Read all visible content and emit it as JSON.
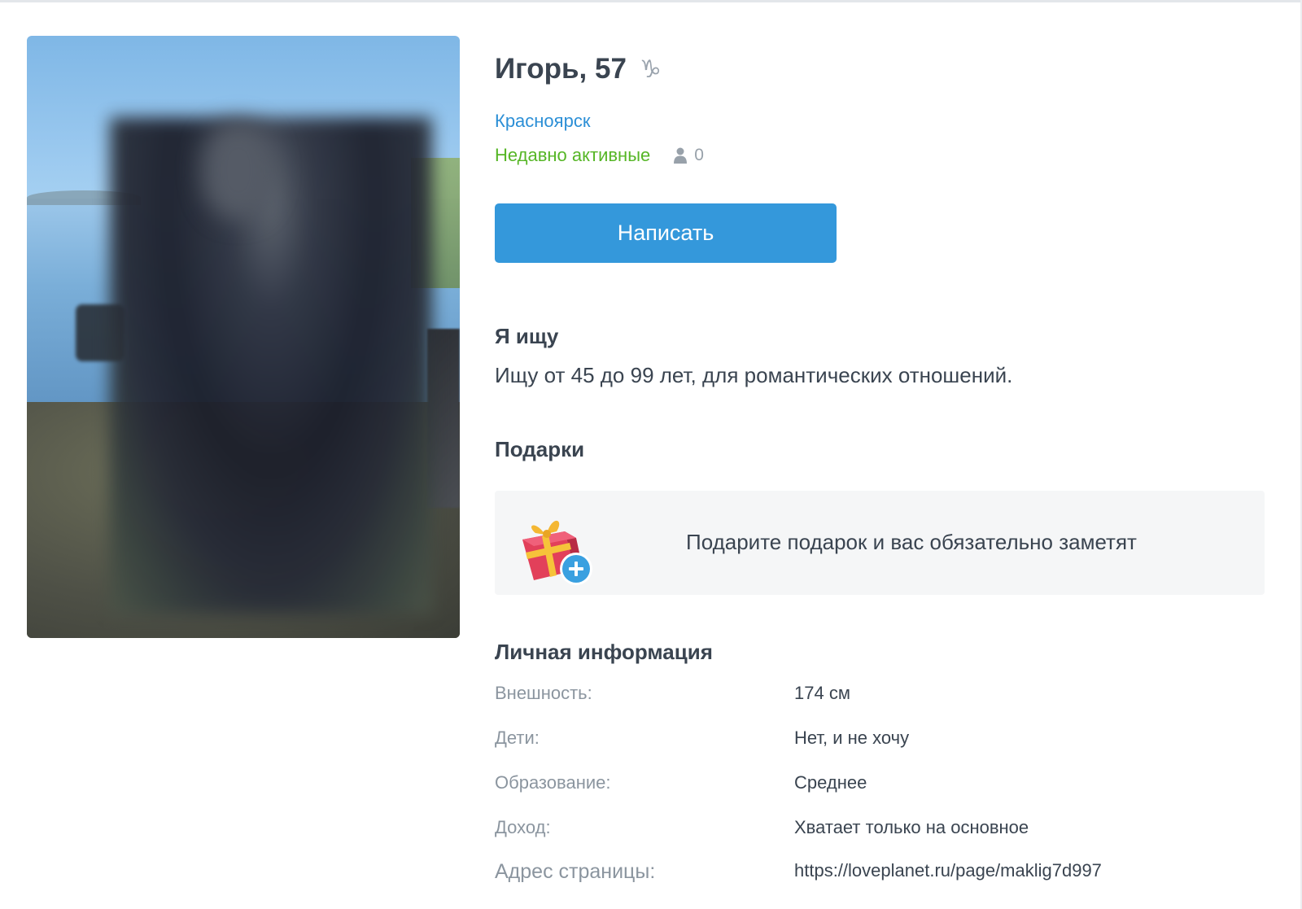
{
  "profile": {
    "name_age": "Игорь, 57",
    "zodiac_icon": "capricorn-icon",
    "city": "Красноярск",
    "status": "Недавно активные",
    "visitors_count": "0"
  },
  "actions": {
    "write_label": "Написать"
  },
  "seeking": {
    "title": "Я ищу",
    "text": "Ищу от 45 до 99 лет, для романтических отношений."
  },
  "gifts": {
    "title": "Подарки",
    "prompt": "Подарите подарок и вас обязательно заметят",
    "icon": "gift-add-icon"
  },
  "personal_info": {
    "title": "Личная информация",
    "rows": [
      {
        "label": "Внешность:",
        "value": "174 см"
      },
      {
        "label": "Дети:",
        "value": "Нет, и не хочу"
      },
      {
        "label": "Образование:",
        "value": "Среднее"
      },
      {
        "label": "Доход:",
        "value": "Хватает только на основное"
      },
      {
        "label": "Адрес страницы:",
        "value": "https://loveplanet.ru/page/maklig7d997"
      }
    ]
  },
  "colors": {
    "accent_blue": "#3498db",
    "link_blue": "#2c8fd6",
    "status_green": "#56b626",
    "text_dark": "#3a4450",
    "text_muted": "#8b959f"
  }
}
